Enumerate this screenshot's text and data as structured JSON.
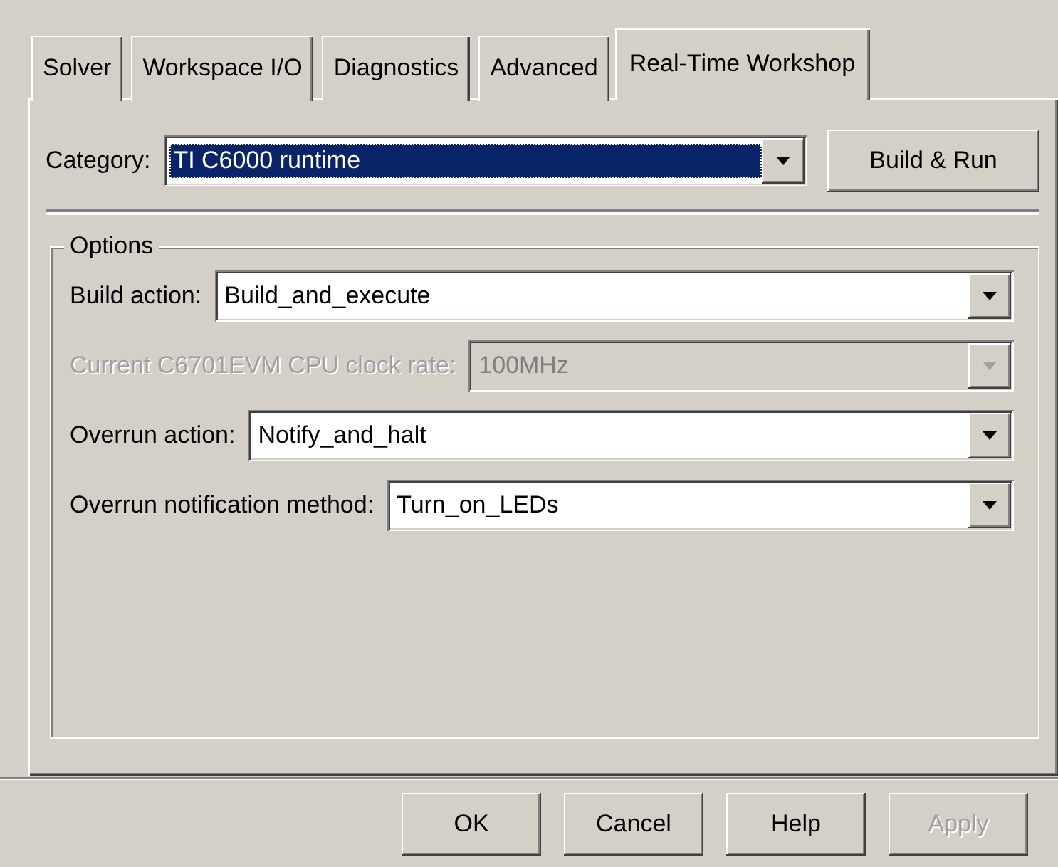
{
  "tabs": [
    {
      "label": "Solver",
      "selected": false
    },
    {
      "label": "Workspace I/O",
      "selected": false
    },
    {
      "label": "Diagnostics",
      "selected": false
    },
    {
      "label": "Advanced",
      "selected": false
    },
    {
      "label": "Real-Time Workshop",
      "selected": true
    }
  ],
  "category": {
    "label": "Category:",
    "value": "TI C6000 runtime",
    "highlighted": true,
    "button": "Build & Run"
  },
  "options": {
    "title": "Options",
    "fields": [
      {
        "label": "Build action:",
        "value": "Build_and_execute",
        "disabled": false
      },
      {
        "label": "Current C6701EVM CPU clock rate:",
        "value": "100MHz",
        "disabled": true
      },
      {
        "label": "Overrun action:",
        "value": "Notify_and_halt",
        "disabled": false
      },
      {
        "label": "Overrun notification method:",
        "value": "Turn_on_LEDs",
        "disabled": false
      }
    ]
  },
  "buttons": [
    {
      "label": "OK",
      "disabled": false
    },
    {
      "label": "Cancel",
      "disabled": false
    },
    {
      "label": "Help",
      "disabled": false
    },
    {
      "label": "Apply",
      "disabled": true
    }
  ]
}
